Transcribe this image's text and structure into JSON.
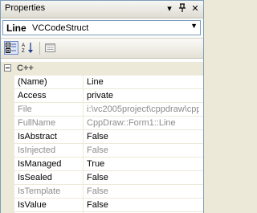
{
  "window": {
    "title": "Properties"
  },
  "titlebar_buttons": {
    "dropdown": "▾",
    "pin": "⊥",
    "close": "✕"
  },
  "selector": {
    "object_name": "Line",
    "object_type": "VCCodeStruct",
    "dropdown_icon": "▼"
  },
  "toolbar": {
    "buttons": [
      {
        "name": "categorized-button",
        "icon": "categorized-icon",
        "active": true
      },
      {
        "name": "alphabetical-button",
        "icon": "alphabetical-icon",
        "active": false
      },
      {
        "name": "property-pages-button",
        "icon": "property-pages-icon",
        "active": false
      }
    ]
  },
  "grid": {
    "category": "C++",
    "properties": [
      {
        "name": "(Name)",
        "value": "Line",
        "readonly": false
      },
      {
        "name": "Access",
        "value": "private",
        "readonly": false
      },
      {
        "name": "File",
        "value": "i:\\vc2005project\\cppdraw\\cpp",
        "readonly": true
      },
      {
        "name": "FullName",
        "value": "CppDraw::Form1::Line",
        "readonly": true
      },
      {
        "name": "IsAbstract",
        "value": "False",
        "readonly": false
      },
      {
        "name": "IsInjected",
        "value": "False",
        "readonly": true
      },
      {
        "name": "IsManaged",
        "value": "True",
        "readonly": false
      },
      {
        "name": "IsSealed",
        "value": "False",
        "readonly": false
      },
      {
        "name": "IsTemplate",
        "value": "False",
        "readonly": true
      },
      {
        "name": "IsValue",
        "value": "False",
        "readonly": false
      }
    ]
  },
  "colors": {
    "border": "#7f9db9",
    "readonly_text": "#8c8c8c",
    "panel_background": "#ece9d8"
  }
}
